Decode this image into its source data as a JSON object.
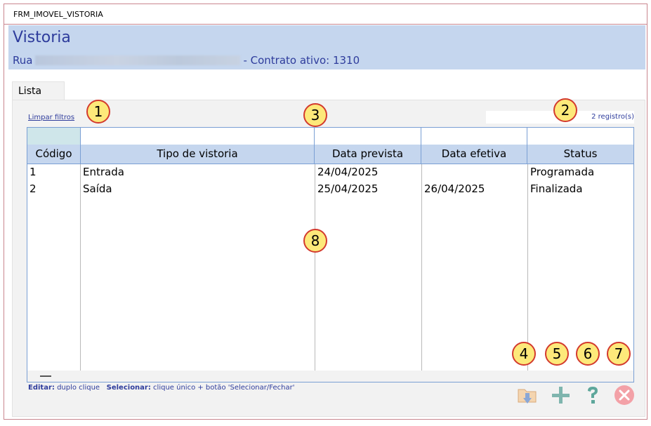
{
  "window": {
    "title": "FRM_IMOVEL_VISTORIA"
  },
  "header": {
    "title": "Vistoria",
    "address_prefix": "Rua",
    "address_suffix": "- Contrato ativo: 1310"
  },
  "tabs": [
    {
      "label": "Lista"
    }
  ],
  "toolbar": {
    "clear_filters": "Limpar filtros",
    "record_count": "2 registro(s)"
  },
  "table": {
    "columns": [
      "Código",
      "Tipo de vistoria",
      "Data prevista",
      "Data efetiva",
      "Status"
    ],
    "rows": [
      [
        "1",
        "Entrada",
        "24/04/2025",
        "",
        "Programada"
      ],
      [
        "2",
        "Saída",
        "25/04/2025",
        "26/04/2025",
        "Finalizada"
      ]
    ]
  },
  "hint": {
    "edit_label": "Editar:",
    "edit_text": "duplo clique",
    "select_label": "Selecionar:",
    "select_text": "clique único + botão 'Selecionar/Fechar'"
  },
  "buttons": {
    "export_icon": "folder-download-icon",
    "add_icon": "plus-icon",
    "help_icon": "question-icon",
    "close_icon": "close-circle-icon"
  },
  "markers": [
    "1",
    "2",
    "3",
    "4",
    "5",
    "6",
    "7",
    "8"
  ],
  "colors": {
    "accent": "#2e3c9c",
    "header_bg": "#c5d6ee",
    "border": "#c9868f",
    "grid_border": "#7a9fd4",
    "marker_fill": "#fde97a",
    "marker_stroke": "#d33a2e"
  }
}
